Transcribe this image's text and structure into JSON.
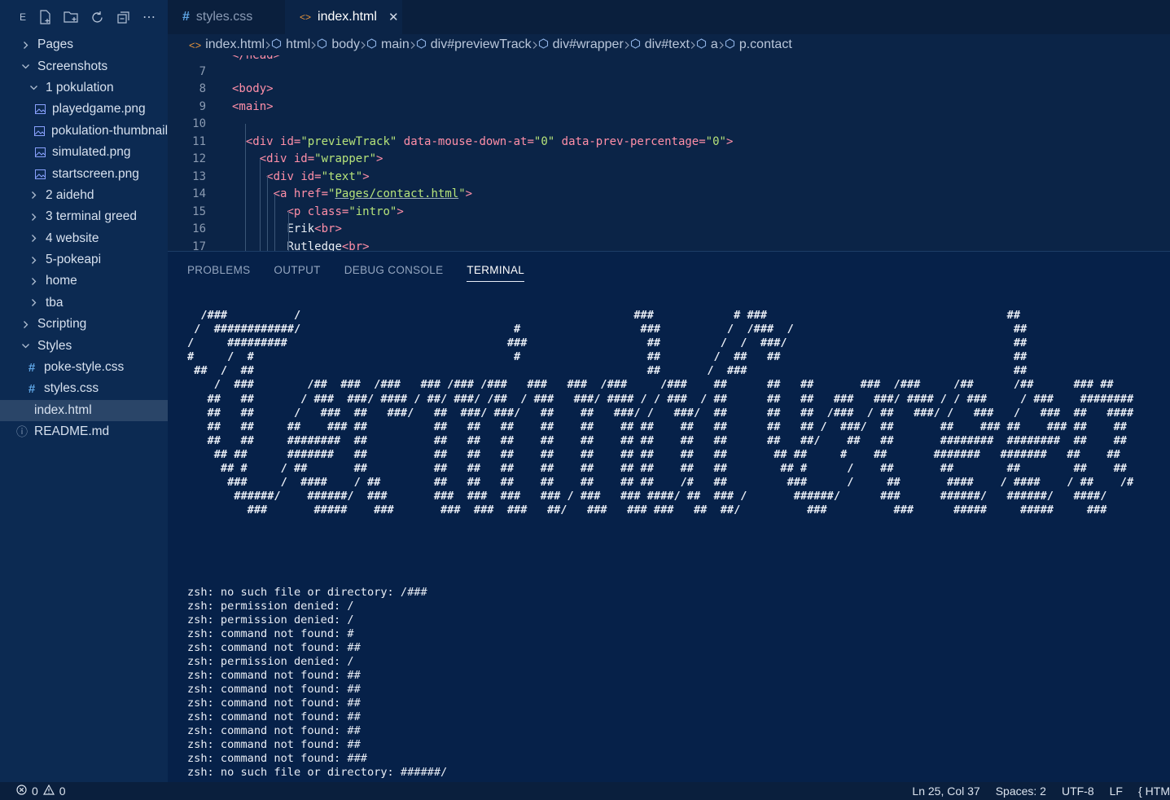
{
  "sidebar": {
    "explorer_letter": "E",
    "tree": [
      {
        "label": "Pages",
        "type": "folder",
        "expanded": false,
        "depth": 0
      },
      {
        "label": "Screenshots",
        "type": "folder",
        "expanded": true,
        "depth": 0
      },
      {
        "label": "1 pokulation",
        "type": "folder",
        "expanded": true,
        "depth": 1
      },
      {
        "label": "playedgame.png",
        "type": "image",
        "depth": 2
      },
      {
        "label": "pokulation-thumbnail.png",
        "type": "image",
        "depth": 2
      },
      {
        "label": "simulated.png",
        "type": "image",
        "depth": 2
      },
      {
        "label": "startscreen.png",
        "type": "image",
        "depth": 2
      },
      {
        "label": "2 aidehd",
        "type": "folder",
        "expanded": false,
        "depth": 1
      },
      {
        "label": "3 terminal greed",
        "type": "folder",
        "expanded": false,
        "depth": 1
      },
      {
        "label": "4 website",
        "type": "folder",
        "expanded": false,
        "depth": 1
      },
      {
        "label": "5-pokeapi",
        "type": "folder",
        "expanded": false,
        "depth": 1
      },
      {
        "label": "home",
        "type": "folder",
        "expanded": false,
        "depth": 1
      },
      {
        "label": "tba",
        "type": "folder",
        "expanded": false,
        "depth": 1
      },
      {
        "label": "Scripting",
        "type": "folder",
        "expanded": false,
        "depth": 0
      },
      {
        "label": "Styles",
        "type": "folder",
        "expanded": true,
        "depth": 0
      },
      {
        "label": "poke-style.css",
        "type": "css",
        "depth": 1
      },
      {
        "label": "styles.css",
        "type": "css",
        "depth": 1
      },
      {
        "label": "index.html",
        "type": "html",
        "depth": 0,
        "selected": true
      },
      {
        "label": "README.md",
        "type": "info",
        "depth": 0
      }
    ]
  },
  "tabs": [
    {
      "label": "styles.css",
      "icon": "#"
    },
    {
      "label": "index.html",
      "icon": "<>",
      "active": true
    }
  ],
  "breadcrumb": [
    "index.html",
    "html",
    "body",
    "main",
    "div#previewTrack",
    "div#wrapper",
    "div#text",
    "a",
    "p.contact"
  ],
  "editor": {
    "lines": [
      {
        "n": "7",
        "html": ""
      },
      {
        "n": "8",
        "html": "<span class=\"tag\">&lt;body&gt;</span>"
      },
      {
        "n": "9",
        "html": "<span class=\"tag\">&lt;main&gt;</span>"
      },
      {
        "n": "10",
        "html": ""
      },
      {
        "n": "11",
        "html": "  <span class=\"tag\">&lt;div</span> <span class=\"attr\">id=</span><span class=\"str\">\"previewTrack\"</span> <span class=\"attr\">data-mouse-down-at=</span><span class=\"str\">\"0\"</span> <span class=\"attr\">data-prev-percentage=</span><span class=\"str\">\"0\"</span><span class=\"tag\">&gt;</span>"
      },
      {
        "n": "12",
        "html": "    <span class=\"tag\">&lt;div</span> <span class=\"attr\">id=</span><span class=\"str\">\"wrapper\"</span><span class=\"tag\">&gt;</span>"
      },
      {
        "n": "13",
        "html": "     <span class=\"tag\">&lt;div</span> <span class=\"attr\">id=</span><span class=\"str\">\"text\"</span><span class=\"tag\">&gt;</span>"
      },
      {
        "n": "14",
        "html": "      <span class=\"tag\">&lt;a</span> <span class=\"attr\">href=</span><span class=\"str\">\"<span class=\"link\">Pages/contact.html</span>\"</span><span class=\"tag\">&gt;</span>"
      },
      {
        "n": "15",
        "html": "        <span class=\"tag\">&lt;p</span> <span class=\"attr\">class=</span><span class=\"str\">\"intro\"</span><span class=\"tag\">&gt;</span>"
      },
      {
        "n": "16",
        "html": "        <span class=\"txt\">Erik</span><span class=\"tag\">&lt;br&gt;</span>"
      },
      {
        "n": "17",
        "html": "        <span class=\"txt\">Rutledge</span><span class=\"tag\">&lt;br&gt;</span>"
      }
    ]
  },
  "panel": {
    "tabs": [
      "PROBLEMS",
      "OUTPUT",
      "DEBUG CONSOLE",
      "TERMINAL"
    ],
    "active_tab": "TERMINAL",
    "ascii_art": "  /###          /                                                  ###            # ###                                    ##\n /  ############/                                #                  ###          /  /###  /                                 ##\n/     #########                                 ###                  ##         /  /  ###/                                  ##\n#     /  #                                       #                   ##        /  ##   ##                                   ##\n ##  /  ##                                                           ##       /  ###                                        ##\n    /  ###        /##  ###  /###   ### /### /###   ###   ###  /###     /###    ##      ##   ##       ###  /###     /##      /##      ### ##\n   ##   ##       / ###  ###/ #### / ##/ ###/ /##  / ###   ###/ #### / / ###  / ##      ##   ##   ###   ###/ #### / / ###     / ###    ########\n   ##   ##      /   ###  ##   ###/   ##  ###/ ###/   ##    ##   ###/ /   ###/  ##      ##   ##  /###  / ##   ###/ /   ###   /   ###  ##   ####\n   ##   ##     ##    ### ##          ##   ##   ##    ##    ##    ## ##    ##   ##      ##   ## /  ###/  ##       ##    ### ##    ### ##    ##\n   ##   ##     ########  ##          ##   ##   ##    ##    ##    ## ##    ##   ##      ##   ##/    ##   ##       ########  ########  ##    ##\n    ## ##      #######   ##          ##   ##   ##    ##    ##    ## ##    ##   ##       ## ##     #    ##       #######   #######   ##    ##\n     ## #     / ##       ##          ##   ##   ##    ##    ##    ## ##    ##   ##        ## #      /    ##       ##        ##        ##    ##\n      ###     /  ####    / ##        ##   ##   ##    ##    ##    ## ##    /#   ##         ###      /     ##       ####    / ####    / ##    /#\n       ######/    ######/  ###       ###  ###  ###   ### / ###   ### ####/ ##  ### /       ######/      ###      ######/   ######/   ####/\n         ###       #####    ###       ###  ###  ###   ##/   ###   ### ###   ##  ##/          ###          ###      #####     #####     ###",
    "terminal_output": [
      "zsh: no such file or directory: /###",
      "zsh: permission denied: /",
      "zsh: permission denied: /",
      "zsh: command not found: #",
      "zsh: command not found: ##",
      "zsh: permission denied: /",
      "zsh: command not found: ##",
      "zsh: command not found: ##",
      "zsh: command not found: ##",
      "zsh: command not found: ##",
      "zsh: command not found: ##",
      "zsh: command not found: ##",
      "zsh: command not found: ###",
      "zsh: no such file or directory: ######/"
    ]
  },
  "status": {
    "errors": "0",
    "warnings": "0",
    "position": "Ln 25, Col 37",
    "spaces": "Spaces: 2",
    "encoding": "UTF-8",
    "eol": "LF",
    "language": "HTM"
  },
  "colors": {
    "background": "#0b2447",
    "sidebar": "#0c2a52",
    "panel": "#062149",
    "tag": "#ff8fa8",
    "string": "#b6e37a"
  }
}
